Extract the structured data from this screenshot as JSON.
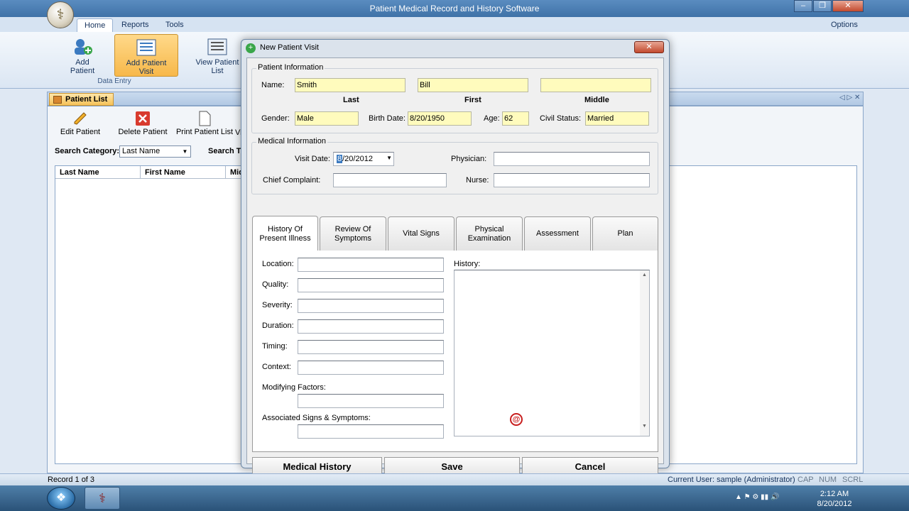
{
  "app": {
    "title": "Patient Medical Record and History Software",
    "options": "Options"
  },
  "ribbon": {
    "tabs": [
      "Home",
      "Reports",
      "Tools"
    ],
    "buttons": [
      "Add Patient",
      "Add Patient Visit",
      "View Patient List"
    ],
    "group_label": "Data Entry"
  },
  "panel": {
    "title": "Patient List",
    "toolbar": [
      "Edit Patient",
      "Delete Patient",
      "Print Patient List",
      "View Patient Visit"
    ],
    "search_category_label": "Search Category:",
    "search_category_value": "Last Name",
    "search_text_label": "Search Text:",
    "columns": [
      "Last Name",
      "First Name",
      "Middle Name"
    ]
  },
  "status": {
    "record": "Record 1 of 3",
    "user": "Current User: sample (Administrator)",
    "cap": "CAP",
    "num": "NUM",
    "scrl": "SCRL"
  },
  "clock": {
    "time": "2:12 AM",
    "date": "8/20/2012"
  },
  "dialog": {
    "title": "New Patient Visit",
    "patient_info_label": "Patient Information",
    "name_label": "Name:",
    "last": "Smith",
    "first": "Bill",
    "middle": "",
    "last_caption": "Last",
    "first_caption": "First",
    "middle_caption": "Middle",
    "gender_label": "Gender:",
    "gender": "Male",
    "birth_label": "Birth Date:",
    "birth": "8/20/1950",
    "age_label": "Age:",
    "age": "62",
    "civil_label": "Civil Status:",
    "civil": "Married",
    "medical_info_label": "Medical Information",
    "visit_date_label": "Visit Date:",
    "visit_date": "/20/2012",
    "visit_month": "8",
    "physician_label": "Physician:",
    "complaint_label": "Chief Complaint:",
    "nurse_label": "Nurse:",
    "tabs": [
      {
        "line1": "History Of",
        "line2": "Present Illness"
      },
      {
        "line1": "Review Of",
        "line2": "Symptoms"
      },
      {
        "line1": "Vital Signs",
        "line2": ""
      },
      {
        "line1": "Physical",
        "line2": "Examination"
      },
      {
        "line1": "Assessment",
        "line2": ""
      },
      {
        "line1": "Plan",
        "line2": ""
      }
    ],
    "fields": [
      "Location:",
      "Quality:",
      "Severity:",
      "Duration:",
      "Timing:",
      "Context:"
    ],
    "modifying_label": "Modifying Factors:",
    "associated_label": "Associated Signs & Symptoms:",
    "history_label": "History:",
    "buttons": {
      "medical_history": "Medical History",
      "save": "Save",
      "cancel": "Cancel"
    }
  },
  "colors": {
    "accent": "#f7b84a",
    "field_yellow": "#fffbbd",
    "titlebar": "#4a7db5"
  }
}
